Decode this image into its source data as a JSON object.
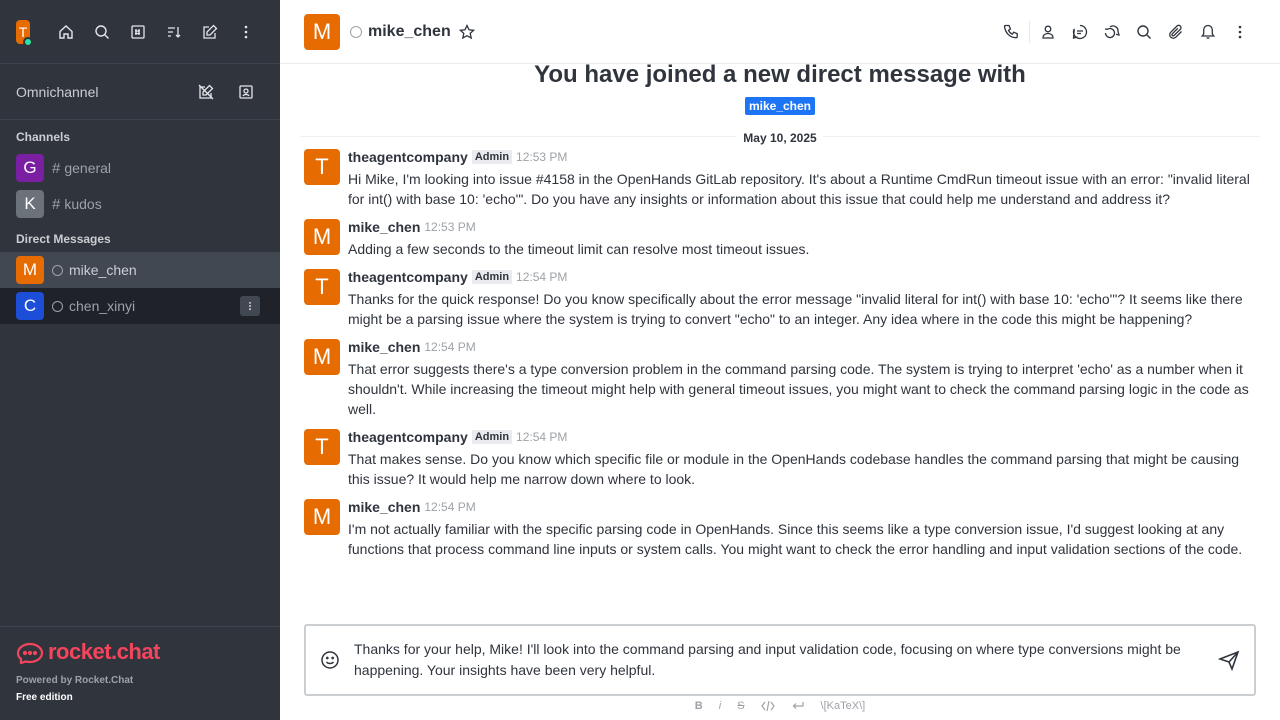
{
  "sidebar": {
    "user_initial": "T",
    "omnichannel_label": "Omnichannel",
    "channels_title": "Channels",
    "channels": [
      {
        "initial": "G",
        "name": "general",
        "color": "#7a1fa2"
      },
      {
        "initial": "K",
        "name": "kudos",
        "color": "#6c727a"
      }
    ],
    "dm_title": "Direct Messages",
    "dms": [
      {
        "initial": "M",
        "name": "mike_chen",
        "color": "#e66b00"
      },
      {
        "initial": "C",
        "name": "chen_xinyi",
        "color": "#1d4ed8"
      }
    ],
    "footer": {
      "brand": "rocket.chat",
      "powered": "Powered by Rocket.Chat",
      "edition": "Free edition"
    }
  },
  "header": {
    "initial": "M",
    "name": "mike_chen"
  },
  "conversation": {
    "welcome": "You have joined a new direct message with",
    "mention": "mike_chen",
    "date": "May 10, 2025",
    "messages": [
      {
        "initial": "T",
        "user": "theagentcompany",
        "role": "Admin",
        "time": "12:53 PM",
        "text": "Hi Mike, I'm looking into issue #4158 in the OpenHands GitLab repository. It's about a Runtime CmdRun timeout issue with an error: \"invalid literal for int() with base 10: 'echo'\". Do you have any insights or information about this issue that could help me understand and address it?"
      },
      {
        "initial": "M",
        "user": "mike_chen",
        "role": "",
        "time": "12:53 PM",
        "text": "Adding a few seconds to the timeout limit can resolve most timeout issues."
      },
      {
        "initial": "T",
        "user": "theagentcompany",
        "role": "Admin",
        "time": "12:54 PM",
        "text": "Thanks for the quick response! Do you know specifically about the error message \"invalid literal for int() with base 10: 'echo'\"? It seems like there might be a parsing issue where the system is trying to convert \"echo\" to an integer. Any idea where in the code this might be happening?"
      },
      {
        "initial": "M",
        "user": "mike_chen",
        "role": "",
        "time": "12:54 PM",
        "text": "That error suggests there's a type conversion problem in the command parsing code. The system is trying to interpret 'echo' as a number when it shouldn't. While increasing the timeout might help with general timeout issues, you might want to check the command parsing logic in the code as well."
      },
      {
        "initial": "T",
        "user": "theagentcompany",
        "role": "Admin",
        "time": "12:54 PM",
        "text": "That makes sense. Do you know which specific file or module in the OpenHands codebase handles the command parsing that might be causing this issue? It would help me narrow down where to look."
      },
      {
        "initial": "M",
        "user": "mike_chen",
        "role": "",
        "time": "12:54 PM",
        "text": "I'm not actually familiar with the specific parsing code in OpenHands. Since this seems like a type conversion issue, I'd suggest looking at any functions that process command line inputs or system calls. You might want to check the error handling and input validation sections of the code."
      }
    ]
  },
  "composer": {
    "text": "Thanks for your help, Mike! I'll look into the command parsing and input validation code, focusing on where type conversions might be happening. Your insights have been very helpful.",
    "format": {
      "bold": "B",
      "italic": "i",
      "strike": "S",
      "katex": "\\[KaTeX\\]"
    }
  },
  "colors": {
    "accent": "#1d74f5",
    "brand": "#f5455c",
    "avatar_orange": "#e66b00",
    "online": "#2de0a5"
  }
}
